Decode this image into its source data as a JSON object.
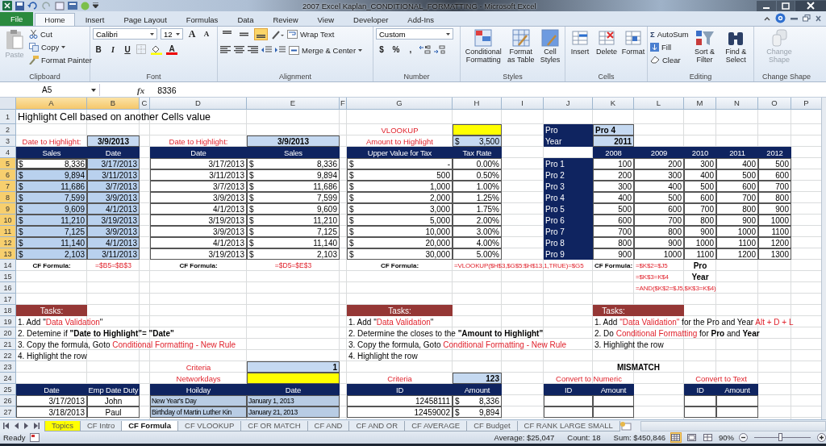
{
  "window": {
    "title": "2007 Excel Kaplan_CONDITIONAL_FORMATTING  -  Microsoft Excel"
  },
  "ribbon": {
    "tabs": [
      {
        "label": "File",
        "kind": "file",
        "selected": false
      },
      {
        "label": "Home",
        "kind": "tab",
        "selected": true
      },
      {
        "label": "Insert",
        "kind": "tab",
        "selected": false
      },
      {
        "label": "Page Layout",
        "kind": "tab",
        "selected": false
      },
      {
        "label": "Formulas",
        "kind": "tab",
        "selected": false
      },
      {
        "label": "Data",
        "kind": "tab",
        "selected": false
      },
      {
        "label": "Review",
        "kind": "tab",
        "selected": false
      },
      {
        "label": "View",
        "kind": "tab",
        "selected": false
      },
      {
        "label": "Developer",
        "kind": "tab",
        "selected": false
      },
      {
        "label": "Add-Ins",
        "kind": "tab",
        "selected": false
      }
    ],
    "clipboard": {
      "label": "Clipboard",
      "paste": "Paste",
      "cut": "Cut",
      "copy": "Copy",
      "format_painter": "Format Painter"
    },
    "font": {
      "label": "Font",
      "family": "Calibri",
      "size": "12",
      "grow": "A",
      "shrink": "A",
      "bold": "B",
      "italic": "I",
      "underline": "U",
      "font_color": "A"
    },
    "alignment": {
      "label": "Alignment",
      "vertical": [
        {
          "selected": false
        },
        {
          "selected": false
        },
        {
          "selected": true
        }
      ],
      "wrap_text": "Wrap Text",
      "merge": "Merge & Center"
    },
    "number": {
      "label": "Number",
      "format": "Custom",
      "currency": "$",
      "percent": "%",
      "comma": ","
    },
    "styles": {
      "label": "Styles",
      "buttons": [
        "Conditional Formatting",
        "Format as Table",
        "Cell Styles"
      ]
    },
    "cells": {
      "label": "Cells",
      "buttons": [
        "Insert",
        "Delete",
        "Format"
      ]
    },
    "editing": {
      "label": "Editing",
      "sigma": "Σ",
      "autosum": "AutoSum",
      "fill": "Fill",
      "clear": "Clear",
      "sort": "Sort & Filter",
      "find": "Find & Select"
    },
    "change_shape": {
      "label": "Change Shape",
      "button": "Change Shape",
      "disabled": true
    }
  },
  "formula_bar": {
    "name_box": "A5",
    "function_label": "fx",
    "value": "8336"
  },
  "sheet": {
    "columns": [
      {
        "label": "A",
        "selected": true
      },
      {
        "label": "B",
        "selected": true
      },
      {
        "label": "C",
        "selected": false
      },
      {
        "label": "D",
        "selected": false
      },
      {
        "label": "E",
        "selected": false
      },
      {
        "label": "F",
        "selected": false
      },
      {
        "label": "G",
        "selected": false
      },
      {
        "label": "H",
        "selected": false
      },
      {
        "label": "I",
        "selected": false
      },
      {
        "label": "J",
        "selected": false
      },
      {
        "label": "K",
        "selected": false
      },
      {
        "label": "L",
        "selected": false
      },
      {
        "label": "M",
        "selected": false
      },
      {
        "label": "N",
        "selected": false
      },
      {
        "label": "O",
        "selected": false
      },
      {
        "label": "P",
        "selected": false
      }
    ],
    "rows": [
      {
        "number": "1",
        "selected": false,
        "cells": [
          {
            "kind": "title",
            "text": "Highlight Cell based on another Cells value"
          },
          null,
          null,
          null,
          null,
          null,
          null,
          null,
          null,
          null,
          null,
          null,
          null,
          null,
          null,
          null
        ]
      },
      {
        "number": "2",
        "selected": false,
        "cells": [
          null,
          null,
          null,
          null,
          null,
          null,
          {
            "kind": "label",
            "text": "VLOOKUP"
          },
          {
            "kind": "yellow"
          },
          null,
          {
            "kind": "side-header",
            "text": "Pro"
          },
          {
            "kind": "input-text",
            "text": "Pro 4"
          },
          null,
          null,
          null,
          null,
          null
        ]
      },
      {
        "number": "3",
        "selected": false,
        "cells": [
          {
            "kind": "label",
            "text": "Date to Highlight:"
          },
          {
            "kind": "input-heading",
            "text": "3/9/2013"
          },
          null,
          {
            "kind": "label",
            "text": "Date to Highlight:"
          },
          {
            "kind": "input-heading",
            "text": "3/9/2013"
          },
          null,
          {
            "kind": "label",
            "text": "Amount to Highlight"
          },
          {
            "kind": "input-money",
            "symbol": "$",
            "text": "3,500"
          },
          null,
          {
            "kind": "side-header",
            "text": "Year"
          },
          {
            "kind": "input",
            "text": "2011"
          },
          null,
          null,
          null,
          null,
          null
        ]
      },
      {
        "number": "4",
        "selected": false,
        "cells": [
          {
            "kind": "header",
            "text": "Sales"
          },
          {
            "kind": "header",
            "text": "Date"
          },
          null,
          {
            "kind": "header",
            "text": "Date"
          },
          {
            "kind": "header",
            "text": "Sales"
          },
          null,
          {
            "kind": "header",
            "text": "Upper Value for Tax"
          },
          {
            "kind": "header",
            "text": "Tax Rate"
          },
          null,
          null,
          {
            "kind": "header",
            "text": "2008"
          },
          {
            "kind": "header",
            "text": "2009"
          },
          {
            "kind": "header",
            "text": "2010"
          },
          {
            "kind": "header",
            "text": "2011"
          },
          {
            "kind": "header",
            "text": "2012"
          },
          null
        ]
      },
      {
        "number": "5",
        "selected": true,
        "cells": [
          {
            "kind": "money",
            "symbol": "$",
            "text": "8,336"
          },
          {
            "kind": "number",
            "text": "3/17/2013"
          },
          null,
          {
            "kind": "number",
            "text": "3/17/2013"
          },
          {
            "kind": "money",
            "symbol": "$",
            "text": "8,336"
          },
          null,
          {
            "kind": "money",
            "symbol": "$",
            "text": "-"
          },
          {
            "kind": "number",
            "text": "0.00%"
          },
          null,
          {
            "kind": "side-header",
            "text": "Pro 1"
          },
          {
            "kind": "number",
            "text": "100"
          },
          {
            "kind": "number",
            "text": "200"
          },
          {
            "kind": "number",
            "text": "300"
          },
          {
            "kind": "number",
            "text": "400"
          },
          {
            "kind": "number",
            "text": "500"
          },
          null
        ]
      },
      {
        "number": "6",
        "selected": true,
        "cells": [
          {
            "kind": "money",
            "symbol": "$",
            "text": "9,894"
          },
          {
            "kind": "number",
            "text": "3/11/2013"
          },
          null,
          {
            "kind": "number",
            "text": "3/11/2013"
          },
          {
            "kind": "money",
            "symbol": "$",
            "text": "9,894"
          },
          null,
          {
            "kind": "money",
            "symbol": "$",
            "text": "500"
          },
          {
            "kind": "number",
            "text": "0.50%"
          },
          null,
          {
            "kind": "side-header",
            "text": "Pro 2"
          },
          {
            "kind": "number",
            "text": "200"
          },
          {
            "kind": "number",
            "text": "300"
          },
          {
            "kind": "number",
            "text": "400"
          },
          {
            "kind": "number",
            "text": "500"
          },
          {
            "kind": "number",
            "text": "600"
          },
          null
        ]
      },
      {
        "number": "7",
        "selected": true,
        "cells": [
          {
            "kind": "money",
            "symbol": "$",
            "text": "11,686"
          },
          {
            "kind": "number",
            "text": "3/7/2013"
          },
          null,
          {
            "kind": "number",
            "text": "3/7/2013"
          },
          {
            "kind": "money",
            "symbol": "$",
            "text": "11,686"
          },
          null,
          {
            "kind": "money",
            "symbol": "$",
            "text": "1,000"
          },
          {
            "kind": "number",
            "text": "1.00%"
          },
          null,
          {
            "kind": "side-header",
            "text": "Pro 3"
          },
          {
            "kind": "number",
            "text": "300"
          },
          {
            "kind": "number",
            "text": "400"
          },
          {
            "kind": "number",
            "text": "500"
          },
          {
            "kind": "number",
            "text": "600"
          },
          {
            "kind": "number",
            "text": "700"
          },
          null
        ]
      },
      {
        "number": "8",
        "selected": true,
        "cells": [
          {
            "kind": "money",
            "symbol": "$",
            "text": "7,599"
          },
          {
            "kind": "number",
            "text": "3/9/2013"
          },
          null,
          {
            "kind": "number",
            "text": "3/9/2013"
          },
          {
            "kind": "money",
            "symbol": "$",
            "text": "7,599"
          },
          null,
          {
            "kind": "money",
            "symbol": "$",
            "text": "2,000"
          },
          {
            "kind": "number",
            "text": "1.25%"
          },
          null,
          {
            "kind": "side-header",
            "text": "Pro 4"
          },
          {
            "kind": "number",
            "text": "400"
          },
          {
            "kind": "number",
            "text": "500"
          },
          {
            "kind": "number",
            "text": "600"
          },
          {
            "kind": "number",
            "text": "700"
          },
          {
            "kind": "number",
            "text": "800"
          },
          null
        ]
      },
      {
        "number": "9",
        "selected": true,
        "cells": [
          {
            "kind": "money",
            "symbol": "$",
            "text": "9,609"
          },
          {
            "kind": "number",
            "text": "4/1/2013"
          },
          null,
          {
            "kind": "number",
            "text": "4/1/2013"
          },
          {
            "kind": "money",
            "symbol": "$",
            "text": "9,609"
          },
          null,
          {
            "kind": "money",
            "symbol": "$",
            "text": "3,000"
          },
          {
            "kind": "number",
            "text": "1.75%"
          },
          null,
          {
            "kind": "side-header",
            "text": "Pro 5"
          },
          {
            "kind": "number",
            "text": "500"
          },
          {
            "kind": "number",
            "text": "600"
          },
          {
            "kind": "number",
            "text": "700"
          },
          {
            "kind": "number",
            "text": "800"
          },
          {
            "kind": "number",
            "text": "900"
          },
          null
        ]
      },
      {
        "number": "10",
        "selected": true,
        "cells": [
          {
            "kind": "money",
            "symbol": "$",
            "text": "11,210"
          },
          {
            "kind": "number",
            "text": "3/19/2013"
          },
          null,
          {
            "kind": "number",
            "text": "3/19/2013"
          },
          {
            "kind": "money",
            "symbol": "$",
            "text": "11,210"
          },
          null,
          {
            "kind": "money",
            "symbol": "$",
            "text": "5,000"
          },
          {
            "kind": "number",
            "text": "2.00%"
          },
          null,
          {
            "kind": "side-header",
            "text": "Pro 6"
          },
          {
            "kind": "number",
            "text": "600"
          },
          {
            "kind": "number",
            "text": "700"
          },
          {
            "kind": "number",
            "text": "800"
          },
          {
            "kind": "number",
            "text": "900"
          },
          {
            "kind": "number",
            "text": "1000"
          },
          null
        ]
      },
      {
        "number": "11",
        "selected": true,
        "cells": [
          {
            "kind": "money",
            "symbol": "$",
            "text": "7,125"
          },
          {
            "kind": "number",
            "text": "3/9/2013"
          },
          null,
          {
            "kind": "number",
            "text": "3/9/2013"
          },
          {
            "kind": "money",
            "symbol": "$",
            "text": "7,125"
          },
          null,
          {
            "kind": "money",
            "symbol": "$",
            "text": "10,000"
          },
          {
            "kind": "number",
            "text": "3.00%"
          },
          null,
          {
            "kind": "side-header",
            "text": "Pro 7"
          },
          {
            "kind": "number",
            "text": "700"
          },
          {
            "kind": "number",
            "text": "800"
          },
          {
            "kind": "number",
            "text": "900"
          },
          {
            "kind": "number",
            "text": "1000"
          },
          {
            "kind": "number",
            "text": "1100"
          },
          null
        ]
      },
      {
        "number": "12",
        "selected": true,
        "cells": [
          {
            "kind": "money",
            "symbol": "$",
            "text": "11,140"
          },
          {
            "kind": "number",
            "text": "4/1/2013"
          },
          null,
          {
            "kind": "number",
            "text": "4/1/2013"
          },
          {
            "kind": "money",
            "symbol": "$",
            "text": "11,140"
          },
          null,
          {
            "kind": "money",
            "symbol": "$",
            "text": "20,000"
          },
          {
            "kind": "number",
            "text": "4.00%"
          },
          null,
          {
            "kind": "side-header",
            "text": "Pro 8"
          },
          {
            "kind": "number",
            "text": "800"
          },
          {
            "kind": "number",
            "text": "900"
          },
          {
            "kind": "number",
            "text": "1000"
          },
          {
            "kind": "number",
            "text": "1100"
          },
          {
            "kind": "number",
            "text": "1200"
          },
          null
        ]
      },
      {
        "number": "13",
        "selected": true,
        "cells": [
          {
            "kind": "money",
            "symbol": "$",
            "text": "2,103"
          },
          {
            "kind": "number",
            "text": "3/11/2013"
          },
          null,
          {
            "kind": "number",
            "text": "3/19/2013"
          },
          {
            "kind": "money",
            "symbol": "$",
            "text": "2,103"
          },
          null,
          {
            "kind": "money",
            "symbol": "$",
            "text": "30,000"
          },
          {
            "kind": "number",
            "text": "5.00%"
          },
          null,
          {
            "kind": "side-header",
            "text": "Pro 9"
          },
          {
            "kind": "number",
            "text": "900"
          },
          {
            "kind": "number",
            "text": "1000"
          },
          {
            "kind": "number",
            "text": "1100"
          },
          {
            "kind": "number",
            "text": "1200"
          },
          {
            "kind": "number",
            "text": "1300"
          },
          null
        ]
      },
      {
        "number": "14",
        "selected": false,
        "cells": [
          {
            "kind": "formula-label",
            "text": "CF Formula:"
          },
          {
            "kind": "formula",
            "text": "=$B5=$B$3"
          },
          null,
          {
            "kind": "formula-label",
            "text": "CF Formula:"
          },
          {
            "kind": "formula",
            "text": "=$D5=$E$3"
          },
          null,
          {
            "kind": "formula-label",
            "text": "CF Formula:"
          },
          {
            "kind": "formula-left",
            "text": "=VLOOKUP($H$3,$G$5:$H$13,1,TRUE)=$G5"
          },
          null,
          null,
          {
            "kind": "formula-label",
            "text": "CF Formula:"
          },
          {
            "kind": "formula-left",
            "text": "=$K$2=$J5"
          },
          {
            "kind": "bold",
            "text": "Pro"
          },
          null,
          null,
          null
        ]
      },
      {
        "number": "15",
        "selected": false,
        "cells": [
          null,
          null,
          null,
          null,
          null,
          null,
          null,
          null,
          null,
          null,
          null,
          {
            "kind": "formula-left",
            "text": "=$K$3=K$4"
          },
          {
            "kind": "bold",
            "text": "Year"
          },
          null,
          null,
          null
        ]
      },
      {
        "number": "16",
        "selected": false,
        "cells": [
          null,
          null,
          null,
          null,
          null,
          null,
          null,
          null,
          null,
          null,
          null,
          {
            "kind": "formula-left",
            "text": "=AND($K$2=$J5,$K$3=K$4)"
          },
          null,
          null,
          null,
          null
        ]
      },
      {
        "number": "17",
        "selected": false,
        "cells": [
          null,
          null,
          null,
          null,
          null,
          null,
          null,
          null,
          null,
          null,
          null,
          null,
          null,
          null,
          null,
          null
        ]
      },
      {
        "number": "18",
        "selected": false,
        "cells": [
          {
            "kind": "task-header",
            "text": "Tasks:"
          },
          null,
          null,
          null,
          null,
          null,
          {
            "kind": "task-header",
            "text": "Tasks:"
          },
          null,
          null,
          null,
          {
            "kind": "task-header",
            "text": "Tasks:"
          },
          {
            "kind": "task-header"
          },
          null,
          null,
          null,
          null
        ]
      },
      {
        "number": "19",
        "selected": false,
        "cells": [
          {
            "kind": "note",
            "parts": [
              {
                "kind": "plain",
                "text": "1. Add \""
              },
              {
                "kind": "red",
                "text": "Data Validation"
              },
              {
                "kind": "plain",
                "text": "\""
              }
            ]
          },
          null,
          null,
          null,
          null,
          null,
          {
            "kind": "note",
            "parts": [
              {
                "kind": "plain",
                "text": "1. Add \""
              },
              {
                "kind": "red",
                "text": "Data Validation"
              },
              {
                "kind": "plain",
                "text": "\""
              }
            ]
          },
          null,
          null,
          null,
          {
            "kind": "note",
            "parts": [
              {
                "kind": "plain",
                "text": "1. Add "
              },
              {
                "kind": "red",
                "text": "\"Data Validation\""
              },
              {
                "kind": "plain",
                "text": " for the Pro and Year "
              },
              {
                "kind": "red",
                "text": "Alt + D + L"
              }
            ]
          },
          null,
          null,
          null,
          null,
          null
        ]
      },
      {
        "number": "20",
        "selected": false,
        "cells": [
          {
            "kind": "note",
            "parts": [
              {
                "kind": "plain",
                "text": "2. Detemine if "
              },
              {
                "kind": "bold",
                "text": "\"Date to Highlight\""
              },
              {
                "kind": "plain",
                "text": "= "
              },
              {
                "kind": "bold",
                "text": "\"Date\""
              }
            ]
          },
          null,
          null,
          null,
          null,
          null,
          {
            "kind": "note",
            "parts": [
              {
                "kind": "plain",
                "text": "2. Determine the closes to the "
              },
              {
                "kind": "bold",
                "text": "\"Amount to Highlight\""
              }
            ]
          },
          null,
          null,
          null,
          {
            "kind": "note",
            "parts": [
              {
                "kind": "plain",
                "text": "2. Do "
              },
              {
                "kind": "red",
                "text": "Conditional Formatting"
              },
              {
                "kind": "plain",
                "text": " for "
              },
              {
                "kind": "bold",
                "text": "Pro"
              },
              {
                "kind": "plain",
                "text": " and "
              },
              {
                "kind": "bold",
                "text": "Year"
              }
            ]
          },
          null,
          null,
          null,
          null,
          null
        ]
      },
      {
        "number": "21",
        "selected": false,
        "cells": [
          {
            "kind": "note",
            "parts": [
              {
                "kind": "plain",
                "text": "3. Copy the formula, Goto "
              },
              {
                "kind": "red",
                "text": "Conditional Formatting - New Rule"
              }
            ]
          },
          null,
          null,
          null,
          null,
          null,
          {
            "kind": "note",
            "parts": [
              {
                "kind": "plain",
                "text": "3. Copy the formula, Goto "
              },
              {
                "kind": "red",
                "text": "Conditional Formatting - New Rule"
              }
            ]
          },
          null,
          null,
          null,
          {
            "kind": "note",
            "parts": [
              {
                "kind": "plain",
                "text": "3. Highlight the row"
              }
            ]
          },
          null,
          null,
          null,
          null,
          null
        ]
      },
      {
        "number": "22",
        "selected": false,
        "cells": [
          {
            "kind": "note",
            "parts": [
              {
                "kind": "plain",
                "text": "4. Highlight the row"
              }
            ]
          },
          null,
          null,
          null,
          null,
          null,
          {
            "kind": "note",
            "parts": [
              {
                "kind": "plain",
                "text": "4. Highlight the row"
              }
            ]
          },
          null,
          null,
          null,
          null,
          null,
          null,
          null,
          null,
          null
        ]
      },
      {
        "number": "23",
        "selected": false,
        "cells": [
          null,
          null,
          null,
          {
            "kind": "label",
            "text": "Criteria"
          },
          {
            "kind": "input",
            "text": "1"
          },
          null,
          null,
          null,
          null,
          null,
          {
            "kind": "heading",
            "text": "MISMATCH"
          },
          null,
          null,
          null,
          null,
          null
        ]
      },
      {
        "number": "24",
        "selected": false,
        "cells": [
          null,
          null,
          null,
          {
            "kind": "label",
            "text": "Networkdays"
          },
          {
            "kind": "yellow"
          },
          null,
          {
            "kind": "label",
            "text": "Criteria"
          },
          {
            "kind": "input",
            "text": "123"
          },
          null,
          {
            "kind": "label",
            "text": "Convert to Numeric"
          },
          null,
          null,
          {
            "kind": "label",
            "text": "Convert to Text"
          },
          null,
          null,
          null
        ]
      },
      {
        "number": "25",
        "selected": false,
        "cells": [
          {
            "kind": "header",
            "text": "Date"
          },
          {
            "kind": "header",
            "text": "Emp Date Duty"
          },
          null,
          {
            "kind": "header",
            "text": "Hoilday"
          },
          {
            "kind": "header",
            "text": "Date"
          },
          null,
          {
            "kind": "header",
            "text": "ID"
          },
          {
            "kind": "header",
            "text": "Amount"
          },
          null,
          {
            "kind": "header",
            "text": "ID"
          },
          {
            "kind": "header",
            "text": "Amount"
          },
          null,
          {
            "kind": "header",
            "text": "ID"
          },
          {
            "kind": "header",
            "text": "Amount"
          },
          null,
          null
        ]
      },
      {
        "number": "26",
        "selected": false,
        "cells": [
          {
            "kind": "number",
            "text": "3/17/2013"
          },
          {
            "kind": "center",
            "text": "John"
          },
          null,
          {
            "kind": "fill-text",
            "text": "New Year's Day"
          },
          {
            "kind": "fill-text",
            "text": "January 1, 2013"
          },
          null,
          {
            "kind": "number",
            "text": "12458111"
          },
          {
            "kind": "money",
            "symbol": "$",
            "text": "8,336"
          },
          null,
          {
            "kind": "empty-box"
          },
          {
            "kind": "empty-box"
          },
          null,
          {
            "kind": "empty-box"
          },
          {
            "kind": "empty-box"
          },
          null,
          null
        ]
      },
      {
        "number": "27",
        "selected": false,
        "cells": [
          {
            "kind": "number",
            "text": "3/18/2013"
          },
          {
            "kind": "center",
            "text": "Paul"
          },
          null,
          {
            "kind": "fill-text",
            "text": "Birthday of Martin Luther Kin"
          },
          {
            "kind": "fill-text",
            "text": "January 21, 2013"
          },
          null,
          {
            "kind": "number",
            "text": "12459002"
          },
          {
            "kind": "money",
            "symbol": "$",
            "text": "9,894"
          },
          null,
          {
            "kind": "empty-box"
          },
          {
            "kind": "empty-box"
          },
          null,
          {
            "kind": "empty-box"
          },
          {
            "kind": "empty-box"
          },
          null,
          null
        ]
      }
    ]
  },
  "sheet_tabs": [
    {
      "label": "Topics",
      "selected": false,
      "color": "#ffff00"
    },
    {
      "label": "CF Intro",
      "selected": false
    },
    {
      "label": "CF Formula",
      "selected": true
    },
    {
      "label": "CF VLOOKUP",
      "selected": false
    },
    {
      "label": "CF OR MATCH",
      "selected": false
    },
    {
      "label": "CF AND",
      "selected": false
    },
    {
      "label": "CF AND OR",
      "selected": false
    },
    {
      "label": "CF AVERAGE",
      "selected": false
    },
    {
      "label": "CF Budget",
      "selected": false
    },
    {
      "label": "CF RANK LARGE SMALL",
      "selected": false
    }
  ],
  "status_bar": {
    "mode": "Ready",
    "average": "Average: $25,047",
    "count": "Count: 18",
    "sum": "Sum: $450,846",
    "views": [
      {
        "selected": true
      },
      {
        "selected": false
      },
      {
        "selected": false
      }
    ],
    "zoom": "90%",
    "zoom_slider": {
      "level": 0.45
    }
  }
}
